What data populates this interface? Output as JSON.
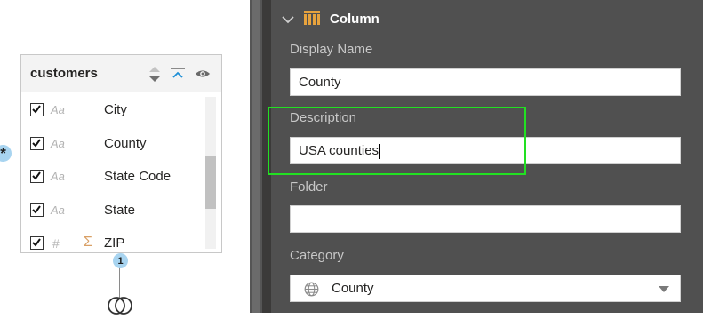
{
  "diagram": {
    "table_title": "customers",
    "fields": [
      {
        "type_glyph": "Aa",
        "aggregate": "",
        "name": "City",
        "checked": true
      },
      {
        "type_glyph": "Aa",
        "aggregate": "",
        "name": "County",
        "checked": true
      },
      {
        "type_glyph": "Aa",
        "aggregate": "",
        "name": "State Code",
        "checked": true
      },
      {
        "type_glyph": "Aa",
        "aggregate": "",
        "name": "State",
        "checked": true
      },
      {
        "type_glyph": "#",
        "aggregate": "Σ",
        "name": "ZIP",
        "checked": true
      }
    ],
    "many_marker": "*",
    "one_marker": "1"
  },
  "panel": {
    "section_title": "Column",
    "display_name": {
      "label": "Display Name",
      "value": "County"
    },
    "description": {
      "label": "Description",
      "value": "USA counties"
    },
    "folder": {
      "label": "Folder",
      "value": ""
    },
    "category": {
      "label": "Category",
      "selected": "County"
    }
  },
  "icons": {
    "section_chevron": "chevron-down-icon",
    "section_icon": "column-icon",
    "category_icon": "globe-icon",
    "header_sort": "sort-icon",
    "header_collapse": "collapse-icon",
    "header_visibility": "eye-icon"
  },
  "colors": {
    "panel_bg": "#3b3a39",
    "section_bg": "#505050",
    "column_icon": "#e8a33d",
    "highlight_box": "#22e022",
    "badge": "#a8d4f0"
  }
}
